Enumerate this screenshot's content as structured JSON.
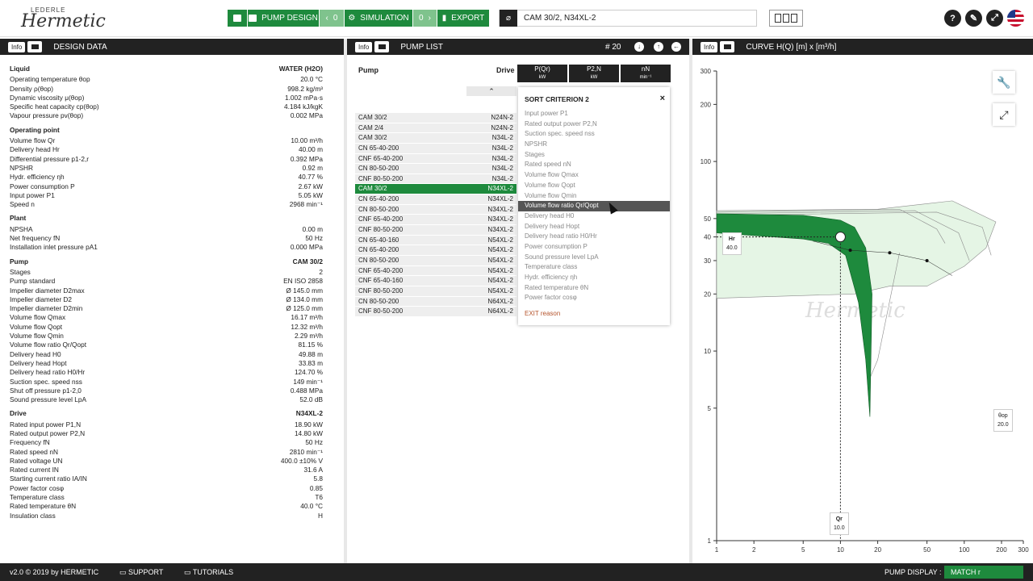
{
  "app": {
    "logo_top": "LEDERLE",
    "logo_main": "Hermetic"
  },
  "toolbar": {
    "pump_design": "PUMP DESIGN",
    "count_a": "0",
    "simulation": "SIMULATION",
    "count_b": "0",
    "export": "EXPORT",
    "pump_selection": "CAM 30/2, N34XL-2"
  },
  "panels": {
    "design": "DESIGN DATA",
    "pumplist": "PUMP LIST",
    "curve": "CURVE H(Q) [m] x [m³/h]",
    "info": "Info",
    "count": "# 20"
  },
  "design": [
    {
      "head": "Liquid",
      "value": "WATER (H2O)",
      "rows": [
        [
          "Operating temperature θop",
          "20.0 °C"
        ],
        [
          "Density ρ(θop)",
          "998.2 kg/m³"
        ],
        [
          "Dynamic viscosity μ(θop)",
          "1.002 mPa·s"
        ],
        [
          "Specific heat capacity cp(θop)",
          "4.184 kJ/kgK"
        ],
        [
          "Vapour pressure pv(θop)",
          "0.002 MPa"
        ]
      ]
    },
    {
      "head": "Operating point",
      "value": "",
      "rows": [
        [
          "Volume flow Qr",
          "10.00 m³/h"
        ],
        [
          "Delivery head Hr",
          "40.00 m"
        ],
        [
          "Differential pressure p1-2,r",
          "0.392 MPa"
        ],
        [
          "NPSHR",
          "0.92 m"
        ],
        [
          "Hydr. efficiency ηh",
          "40.77 %"
        ],
        [
          "Power consumption P",
          "2.67 kW"
        ],
        [
          "Input power P1",
          "5.05 kW"
        ],
        [
          "Speed n",
          "2968 min⁻¹"
        ]
      ]
    },
    {
      "head": "Plant",
      "value": "",
      "rows": [
        [
          "NPSHA",
          "0.00 m"
        ],
        [
          "Net frequency fN",
          "50 Hz"
        ],
        [
          "Installation inlet pressure pA1",
          "0.000 MPa"
        ]
      ]
    },
    {
      "head": "Pump",
      "value": "CAM 30/2",
      "rows": [
        [
          "Stages",
          "2"
        ],
        [
          "Pump standard",
          "EN ISO 2858"
        ],
        [
          "Impeller diameter D2max",
          "Ø 145.0 mm"
        ],
        [
          "Impeller diameter D2",
          "Ø 134.0 mm"
        ],
        [
          "Impeller diameter D2min",
          "Ø 125.0 mm"
        ],
        [
          "Volume flow Qmax",
          "16.17 m³/h"
        ],
        [
          "Volume flow Qopt",
          "12.32 m³/h"
        ],
        [
          "Volume flow Qmin",
          "2.29 m³/h"
        ],
        [
          "Volume flow ratio Qr/Qopt",
          "81.15 %"
        ],
        [
          "Delivery head H0",
          "49.88 m"
        ],
        [
          "Delivery head Hopt",
          "33.83 m"
        ],
        [
          "Delivery head ratio H0/Hr",
          "124.70 %"
        ],
        [
          "Suction spec. speed nss",
          "149 min⁻¹"
        ],
        [
          "Shut off pressure p1-2,0",
          "0.488 MPa"
        ],
        [
          "Sound pressure level LpA",
          "52.0 dB"
        ]
      ]
    },
    {
      "head": "Drive",
      "value": "N34XL-2",
      "rows": [
        [
          "Rated input power P1,N",
          "18.90 kW"
        ],
        [
          "Rated output power P2,N",
          "14.80 kW"
        ],
        [
          "Frequency fN",
          "50 Hz"
        ],
        [
          "Rated speed nN",
          "2810 min⁻¹"
        ],
        [
          "Rated voltage UN",
          "400.0 ±10% V"
        ],
        [
          "Rated current IN",
          "31.6 A"
        ],
        [
          "Starting current ratio IA/IN",
          "5.8"
        ],
        [
          "Power factor cosφ",
          "0.85"
        ],
        [
          "Temperature class",
          "T6"
        ],
        [
          "Rated temperature θN",
          "40.0 °C"
        ],
        [
          "Insulation class",
          "H"
        ]
      ]
    }
  ],
  "pumplist": {
    "col_pump": "Pump",
    "col_drive": "Drive",
    "cols": [
      {
        "t": "P(Qr)",
        "u": "kW"
      },
      {
        "t": "P2,N",
        "u": "kW"
      },
      {
        "t": "nN",
        "u": "min⁻¹"
      }
    ],
    "rows": [
      [
        "CAM 30/2",
        "N24N-2"
      ],
      [
        "CAM 2/4",
        "N24N-2"
      ],
      [
        "CAM 30/2",
        "N34L-2"
      ],
      [
        "CN 65-40-200",
        "N34L-2"
      ],
      [
        "CNF 65-40-200",
        "N34L-2"
      ],
      [
        "CN 80-50-200",
        "N34L-2"
      ],
      [
        "CNF 80-50-200",
        "N34L-2"
      ],
      [
        "CAM 30/2",
        "N34XL-2"
      ],
      [
        "CN 65-40-200",
        "N34XL-2"
      ],
      [
        "CN 80-50-200",
        "N34XL-2"
      ],
      [
        "CNF 65-40-200",
        "N34XL-2"
      ],
      [
        "CNF 80-50-200",
        "N34XL-2"
      ],
      [
        "CN 65-40-160",
        "N54XL-2"
      ],
      [
        "CN 65-40-200",
        "N54XL-2"
      ],
      [
        "CN 80-50-200",
        "N54XL-2"
      ],
      [
        "CNF 65-40-200",
        "N54XL-2"
      ],
      [
        "CNF 65-40-160",
        "N54XL-2"
      ],
      [
        "CNF 80-50-200",
        "N54XL-2"
      ],
      [
        "CN 80-50-200",
        "N64XL-2"
      ],
      [
        "CNF 80-50-200",
        "N64XL-2"
      ]
    ],
    "selected": 7
  },
  "sort": {
    "title": "SORT CRITERION 2",
    "close": "×",
    "exit": "EXIT reason",
    "highlight": 9,
    "items": [
      "Input power P1",
      "Rated output power P2,N",
      "Suction spec. speed nss",
      "NPSHR",
      "Stages",
      "Rated speed nN",
      "Volume flow Qmax",
      "Volume flow Qopt",
      "Volume flow Qmin",
      "Volume flow ratio Qr/Qopt",
      "Delivery head H0",
      "Delivery head Hopt",
      "Delivery head ratio H0/Hr",
      "Power consumption P",
      "Sound pressure level LpA",
      "Temperature class",
      "Hydr. efficiency ηh",
      "Rated temperature θN",
      "Power factor cosφ"
    ]
  },
  "chart_data": {
    "type": "line",
    "x_scale": "log",
    "y_scale": "log",
    "xlim": [
      1,
      300
    ],
    "ylim": [
      1,
      300
    ],
    "x_ticks": [
      "1",
      "2",
      "5",
      "10",
      "20",
      "50",
      "100",
      "200",
      "300"
    ],
    "y_ticks": [
      "1",
      "5",
      "10",
      "20",
      "30",
      "40",
      "50",
      "100",
      "200",
      "300"
    ],
    "operating_point": {
      "x": 10,
      "y": 40
    },
    "markers": {
      "hr_label": "Hr",
      "hr_value": "40.0",
      "qr_label": "Qr",
      "qr_value": "10.0",
      "theta_label": "θop",
      "theta_value": "20.0"
    },
    "watermark": "Hermetic",
    "colors": {
      "selected": "#1e8a3d",
      "others": "#e5f5e5"
    }
  },
  "footer": {
    "version": "v2.0 © 2019 by HERMETIC",
    "support": "SUPPORT",
    "tutorials": "TUTORIALS",
    "pump_display": "PUMP DISPLAY :",
    "match": "MATCH r"
  }
}
